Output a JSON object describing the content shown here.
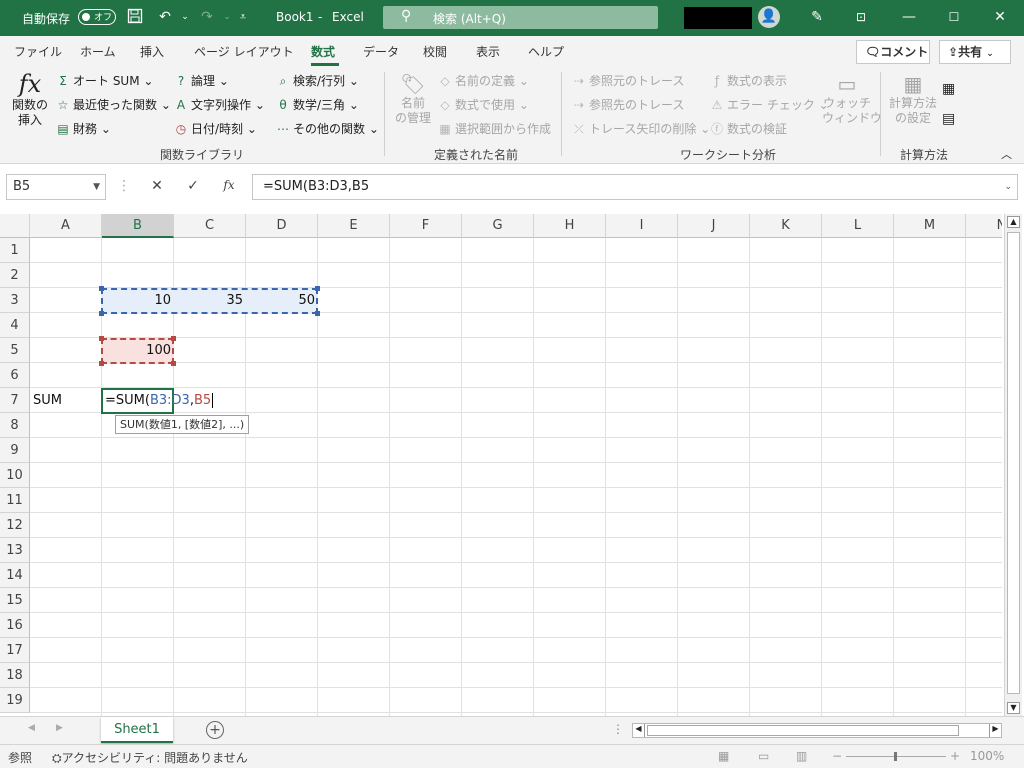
{
  "titlebar": {
    "autosave_label": "自動保存",
    "autosave_state": "オフ",
    "document": "Book1",
    "separator": "-",
    "app": "Excel",
    "search_placeholder": "検索 (Alt+Q)",
    "bg_color": "#217346"
  },
  "ribbon_tabs": [
    "ファイル",
    "ホーム",
    "挿入",
    "ページ レイアウト",
    "数式",
    "データ",
    "校閲",
    "表示",
    "ヘルプ"
  ],
  "active_tab": "数式",
  "comment_button": "コメント",
  "share_button": "共有",
  "function_library": {
    "insert_function_label_line1": "関数の",
    "insert_function_label_line2": "挿入",
    "autosum": "オート SUM",
    "recent": "最近使った関数",
    "financial": "財務",
    "logical": "論理",
    "text": "文字列操作",
    "datetime": "日付/時刻",
    "lookup": "検索/行列",
    "math": "数学/三角",
    "more": "その他の関数",
    "group_label": "関数ライブラリ"
  },
  "defined_names": {
    "name_manager_line1": "名前",
    "name_manager_line2": "の管理",
    "define_name": "名前の定義",
    "use_in_formula": "数式で使用",
    "create_from_selection": "選択範囲から作成",
    "group_label": "定義された名前"
  },
  "formula_auditing": {
    "trace_precedents": "参照元のトレース",
    "trace_dependents": "参照先のトレース",
    "remove_arrows": "トレース矢印の削除",
    "show_formulas": "数式の表示",
    "error_checking": "エラー チェック",
    "evaluate_formula": "数式の検証",
    "watch_window_line1": "ウォッチ",
    "watch_window_line2": "ウィンドウ",
    "group_label": "ワークシート分析"
  },
  "calculation": {
    "options_line1": "計算方法",
    "options_line2": "の設定",
    "group_label": "計算方法"
  },
  "formula_bar": {
    "name_box": "B5",
    "formula": "=SUM(B3:D3,B5"
  },
  "columns": [
    "A",
    "B",
    "C",
    "D",
    "E",
    "F",
    "G",
    "H",
    "I",
    "J",
    "K",
    "L",
    "M",
    "N"
  ],
  "rows": [
    "1",
    "2",
    "3",
    "4",
    "5",
    "6",
    "7",
    "8",
    "9",
    "10",
    "11",
    "12",
    "13",
    "14",
    "15",
    "16",
    "17",
    "18",
    "19"
  ],
  "cells": {
    "B3": "10",
    "C3": "35",
    "D3": "50",
    "B5": "100",
    "A7": "SUM"
  },
  "editing": {
    "prefix": "=SUM(",
    "ref1": "B3:D3",
    "comma": ",",
    "ref2": "B5",
    "ref1_color": "#3a66b0",
    "ref2_color": "#b54a44"
  },
  "tooltip": "SUM(数値1, [数値2], ...)",
  "sheet_tab": "Sheet1",
  "status": {
    "mode": "参照",
    "accessibility": "アクセシビリティ: 問題ありません",
    "zoom": "100%"
  }
}
